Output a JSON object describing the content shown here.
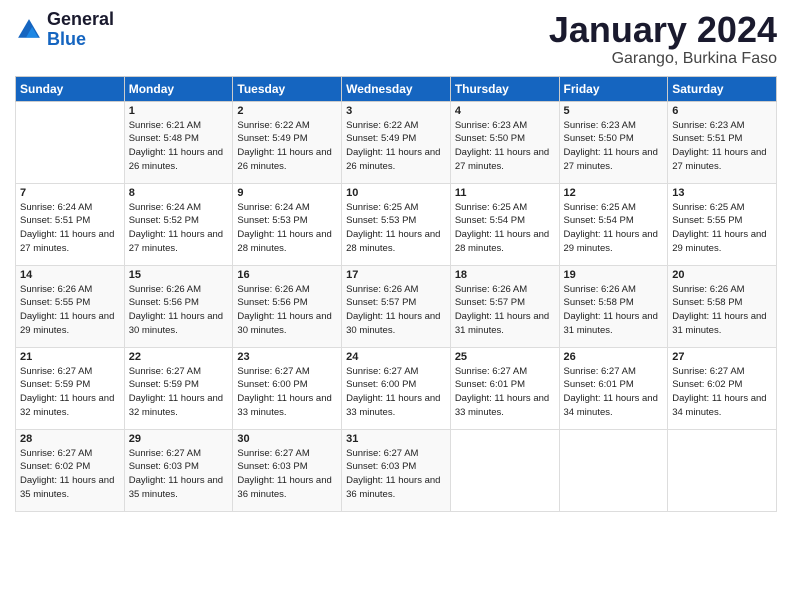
{
  "header": {
    "logo_general": "General",
    "logo_blue": "Blue",
    "month_title": "January 2024",
    "location": "Garango, Burkina Faso"
  },
  "days_of_week": [
    "Sunday",
    "Monday",
    "Tuesday",
    "Wednesday",
    "Thursday",
    "Friday",
    "Saturday"
  ],
  "weeks": [
    [
      {
        "day": "",
        "sunrise": "",
        "sunset": "",
        "daylight": ""
      },
      {
        "day": "1",
        "sunrise": "Sunrise: 6:21 AM",
        "sunset": "Sunset: 5:48 PM",
        "daylight": "Daylight: 11 hours and 26 minutes."
      },
      {
        "day": "2",
        "sunrise": "Sunrise: 6:22 AM",
        "sunset": "Sunset: 5:49 PM",
        "daylight": "Daylight: 11 hours and 26 minutes."
      },
      {
        "day": "3",
        "sunrise": "Sunrise: 6:22 AM",
        "sunset": "Sunset: 5:49 PM",
        "daylight": "Daylight: 11 hours and 26 minutes."
      },
      {
        "day": "4",
        "sunrise": "Sunrise: 6:23 AM",
        "sunset": "Sunset: 5:50 PM",
        "daylight": "Daylight: 11 hours and 27 minutes."
      },
      {
        "day": "5",
        "sunrise": "Sunrise: 6:23 AM",
        "sunset": "Sunset: 5:50 PM",
        "daylight": "Daylight: 11 hours and 27 minutes."
      },
      {
        "day": "6",
        "sunrise": "Sunrise: 6:23 AM",
        "sunset": "Sunset: 5:51 PM",
        "daylight": "Daylight: 11 hours and 27 minutes."
      }
    ],
    [
      {
        "day": "7",
        "sunrise": "Sunrise: 6:24 AM",
        "sunset": "Sunset: 5:51 PM",
        "daylight": "Daylight: 11 hours and 27 minutes."
      },
      {
        "day": "8",
        "sunrise": "Sunrise: 6:24 AM",
        "sunset": "Sunset: 5:52 PM",
        "daylight": "Daylight: 11 hours and 27 minutes."
      },
      {
        "day": "9",
        "sunrise": "Sunrise: 6:24 AM",
        "sunset": "Sunset: 5:53 PM",
        "daylight": "Daylight: 11 hours and 28 minutes."
      },
      {
        "day": "10",
        "sunrise": "Sunrise: 6:25 AM",
        "sunset": "Sunset: 5:53 PM",
        "daylight": "Daylight: 11 hours and 28 minutes."
      },
      {
        "day": "11",
        "sunrise": "Sunrise: 6:25 AM",
        "sunset": "Sunset: 5:54 PM",
        "daylight": "Daylight: 11 hours and 28 minutes."
      },
      {
        "day": "12",
        "sunrise": "Sunrise: 6:25 AM",
        "sunset": "Sunset: 5:54 PM",
        "daylight": "Daylight: 11 hours and 29 minutes."
      },
      {
        "day": "13",
        "sunrise": "Sunrise: 6:25 AM",
        "sunset": "Sunset: 5:55 PM",
        "daylight": "Daylight: 11 hours and 29 minutes."
      }
    ],
    [
      {
        "day": "14",
        "sunrise": "Sunrise: 6:26 AM",
        "sunset": "Sunset: 5:55 PM",
        "daylight": "Daylight: 11 hours and 29 minutes."
      },
      {
        "day": "15",
        "sunrise": "Sunrise: 6:26 AM",
        "sunset": "Sunset: 5:56 PM",
        "daylight": "Daylight: 11 hours and 30 minutes."
      },
      {
        "day": "16",
        "sunrise": "Sunrise: 6:26 AM",
        "sunset": "Sunset: 5:56 PM",
        "daylight": "Daylight: 11 hours and 30 minutes."
      },
      {
        "day": "17",
        "sunrise": "Sunrise: 6:26 AM",
        "sunset": "Sunset: 5:57 PM",
        "daylight": "Daylight: 11 hours and 30 minutes."
      },
      {
        "day": "18",
        "sunrise": "Sunrise: 6:26 AM",
        "sunset": "Sunset: 5:57 PM",
        "daylight": "Daylight: 11 hours and 31 minutes."
      },
      {
        "day": "19",
        "sunrise": "Sunrise: 6:26 AM",
        "sunset": "Sunset: 5:58 PM",
        "daylight": "Daylight: 11 hours and 31 minutes."
      },
      {
        "day": "20",
        "sunrise": "Sunrise: 6:26 AM",
        "sunset": "Sunset: 5:58 PM",
        "daylight": "Daylight: 11 hours and 31 minutes."
      }
    ],
    [
      {
        "day": "21",
        "sunrise": "Sunrise: 6:27 AM",
        "sunset": "Sunset: 5:59 PM",
        "daylight": "Daylight: 11 hours and 32 minutes."
      },
      {
        "day": "22",
        "sunrise": "Sunrise: 6:27 AM",
        "sunset": "Sunset: 5:59 PM",
        "daylight": "Daylight: 11 hours and 32 minutes."
      },
      {
        "day": "23",
        "sunrise": "Sunrise: 6:27 AM",
        "sunset": "Sunset: 6:00 PM",
        "daylight": "Daylight: 11 hours and 33 minutes."
      },
      {
        "day": "24",
        "sunrise": "Sunrise: 6:27 AM",
        "sunset": "Sunset: 6:00 PM",
        "daylight": "Daylight: 11 hours and 33 minutes."
      },
      {
        "day": "25",
        "sunrise": "Sunrise: 6:27 AM",
        "sunset": "Sunset: 6:01 PM",
        "daylight": "Daylight: 11 hours and 33 minutes."
      },
      {
        "day": "26",
        "sunrise": "Sunrise: 6:27 AM",
        "sunset": "Sunset: 6:01 PM",
        "daylight": "Daylight: 11 hours and 34 minutes."
      },
      {
        "day": "27",
        "sunrise": "Sunrise: 6:27 AM",
        "sunset": "Sunset: 6:02 PM",
        "daylight": "Daylight: 11 hours and 34 minutes."
      }
    ],
    [
      {
        "day": "28",
        "sunrise": "Sunrise: 6:27 AM",
        "sunset": "Sunset: 6:02 PM",
        "daylight": "Daylight: 11 hours and 35 minutes."
      },
      {
        "day": "29",
        "sunrise": "Sunrise: 6:27 AM",
        "sunset": "Sunset: 6:03 PM",
        "daylight": "Daylight: 11 hours and 35 minutes."
      },
      {
        "day": "30",
        "sunrise": "Sunrise: 6:27 AM",
        "sunset": "Sunset: 6:03 PM",
        "daylight": "Daylight: 11 hours and 36 minutes."
      },
      {
        "day": "31",
        "sunrise": "Sunrise: 6:27 AM",
        "sunset": "Sunset: 6:03 PM",
        "daylight": "Daylight: 11 hours and 36 minutes."
      },
      {
        "day": "",
        "sunrise": "",
        "sunset": "",
        "daylight": ""
      },
      {
        "day": "",
        "sunrise": "",
        "sunset": "",
        "daylight": ""
      },
      {
        "day": "",
        "sunrise": "",
        "sunset": "",
        "daylight": ""
      }
    ]
  ]
}
